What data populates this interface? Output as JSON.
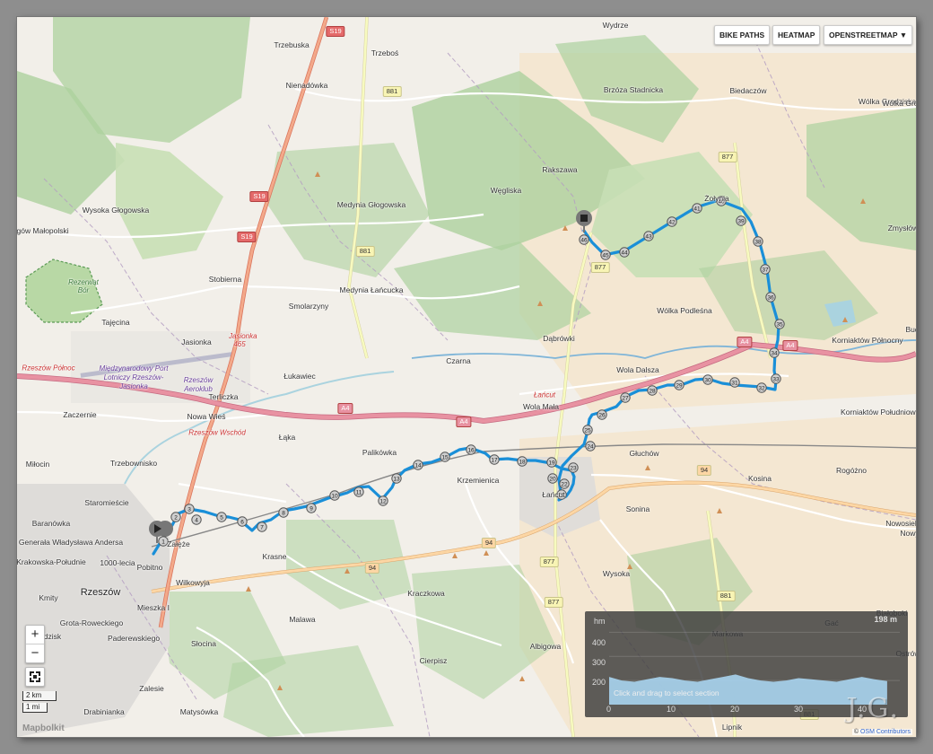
{
  "controls": {
    "bike_paths": "BIKE PATHS",
    "heatmap": "HEATMAP",
    "openstreetmap": "OPENSTREETMAP ▼",
    "zoom_in": "+",
    "zoom_out": "−"
  },
  "scale": {
    "metric": "2 km",
    "imperial": "1 mi"
  },
  "logo": "Mapbolkit",
  "attribution": {
    "prefix": "©",
    "link": "OSM Contributors"
  },
  "watermark": "J.G.",
  "colors": {
    "route": "#1a8fd8",
    "motorway": "#e892a2",
    "primary": "#fcd6a4",
    "secondary": "#f7fabf",
    "forest": "#add19e",
    "farmland": "#eef0d5",
    "residential": "#e0dfdf",
    "water": "#aad3df",
    "profile_fill": "#a9d4f0"
  },
  "profile": {
    "unit_y": "hm",
    "max_label": "198 m",
    "y_ticks": [
      "400",
      "300",
      "200"
    ],
    "x_ticks": [
      "0",
      "10",
      "20",
      "30",
      "40"
    ],
    "hint": "Click and drag to select section",
    "elevation_km": [
      [
        0,
        215
      ],
      [
        2,
        200
      ],
      [
        4,
        195
      ],
      [
        6,
        205
      ],
      [
        8,
        215
      ],
      [
        10,
        210
      ],
      [
        12,
        200
      ],
      [
        14,
        195
      ],
      [
        16,
        205
      ],
      [
        18,
        215
      ],
      [
        20,
        225
      ],
      [
        22,
        210
      ],
      [
        24,
        200
      ],
      [
        26,
        195
      ],
      [
        28,
        200
      ],
      [
        30,
        210
      ],
      [
        32,
        205
      ],
      [
        34,
        200
      ],
      [
        36,
        195
      ],
      [
        38,
        205
      ],
      [
        40,
        215
      ],
      [
        42,
        205
      ],
      [
        44,
        198
      ]
    ]
  },
  "route_markers": [
    "1",
    "2",
    "3",
    "4",
    "5",
    "6",
    "7",
    "8",
    "9",
    "10",
    "11",
    "12",
    "13",
    "14",
    "15",
    "16",
    "17",
    "18",
    "19",
    "20",
    "21",
    "22",
    "23",
    "24",
    "25",
    "26",
    "27",
    "28",
    "29",
    "30",
    "31",
    "32",
    "33",
    "34",
    "35",
    "36",
    "37",
    "38",
    "39",
    "40",
    "41",
    "42",
    "43",
    "44",
    "45",
    "46"
  ],
  "places": [
    {
      "name": "Trzebuska"
    },
    {
      "name": "Trzeboś"
    },
    {
      "name": "Wydrze"
    },
    {
      "name": "Nienadówka"
    },
    {
      "name": "Brzóza Stadnicka"
    },
    {
      "name": "Biedaczów"
    },
    {
      "name": "Wólka Grodziska"
    },
    {
      "name": "Rakszawa"
    },
    {
      "name": "Węgliska"
    },
    {
      "name": "Wysoka Głogowska"
    },
    {
      "name": "Medynia Głogowska"
    },
    {
      "name": "Żołynia"
    },
    {
      "name": "Zmysłówka"
    },
    {
      "name": "Głogów Małopolski"
    },
    {
      "name": "Stobierna"
    },
    {
      "name": "Medynia Łańcucka"
    },
    {
      "name": "Smolarzyny"
    },
    {
      "name": "Wólka Podleśna"
    },
    {
      "name": "Tajęcina"
    },
    {
      "name": "Jasionka"
    },
    {
      "name": "Dąbrówki"
    },
    {
      "name": "Korniaktów Północny"
    },
    {
      "name": "Łukawiec"
    },
    {
      "name": "Czarna"
    },
    {
      "name": "Wola Dalsza"
    },
    {
      "name": "Terliczka"
    },
    {
      "name": "Wola Mała"
    },
    {
      "name": "Korniaktów Południowy"
    },
    {
      "name": "Zaczernie"
    },
    {
      "name": "Nowa Wieś"
    },
    {
      "name": "Rogóżno"
    },
    {
      "name": "Głuchów"
    },
    {
      "name": "Łąka"
    },
    {
      "name": "Palikówka"
    },
    {
      "name": "Trzebownisko"
    },
    {
      "name": "Kosina"
    },
    {
      "name": "Krzemienica"
    },
    {
      "name": "Łańcut"
    },
    {
      "name": "Miłocin"
    },
    {
      "name": "Staromieście"
    },
    {
      "name": "Sonina"
    },
    {
      "name": "Nowosielce"
    },
    {
      "name": "Baranówka"
    },
    {
      "name": "Generała Władysława Andersa"
    },
    {
      "name": "Krakowska-Południe"
    },
    {
      "name": "1000-lecia"
    },
    {
      "name": "Pobitno"
    },
    {
      "name": "Krasne"
    },
    {
      "name": "Wysoka"
    },
    {
      "name": "Wilkowyja"
    },
    {
      "name": "Kmity"
    },
    {
      "name": "Rzeszów"
    },
    {
      "name": "Kraczkowa"
    },
    {
      "name": "Mieszka I"
    },
    {
      "name": "Grota-Roweckiego"
    },
    {
      "name": "Paderewskiego"
    },
    {
      "name": "Malawa"
    },
    {
      "name": "Markowa"
    },
    {
      "name": "Gać"
    },
    {
      "name": "Albigowa"
    },
    {
      "name": "Słocina"
    },
    {
      "name": "Cierpisz"
    },
    {
      "name": "Białoboki"
    },
    {
      "name": "Ostrów"
    },
    {
      "name": "Zalesie"
    },
    {
      "name": "Drabinianka"
    },
    {
      "name": "Matysówka"
    },
    {
      "name": "Lipnik"
    },
    {
      "name": "Ogrodzisk"
    },
    {
      "name": "Załęże"
    },
    {
      "name": "Bud"
    },
    {
      "name": "Wólka Grodzis"
    },
    {
      "name": "Nowy"
    }
  ],
  "special_labels": {
    "airport": "Międzynarodowy Port Lotniczy Rzeszów-Jasionka",
    "aeroklub": "Rzeszów Aeroklub",
    "reserve": "Rezerwat Bór",
    "station_east": "Rzeszów Wschód",
    "station_west": "Rzeszów Północ",
    "jasionka_exit": "Jasionka 465",
    "lancut_station": "Łańcut"
  },
  "road_shields": {
    "s19": "S19",
    "r881": "881",
    "r877": "877",
    "a4": "A4",
    "r94": "94"
  }
}
